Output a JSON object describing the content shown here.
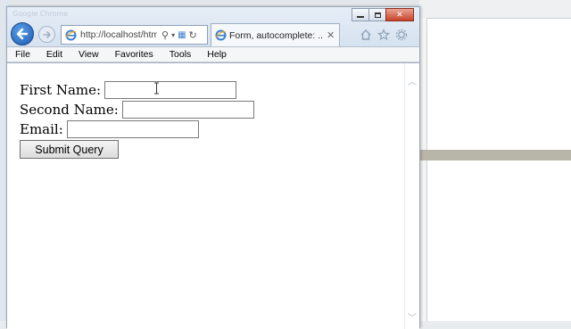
{
  "window": {
    "title_faint": "Google Chrome",
    "controls": [
      "minimize",
      "maximize",
      "close"
    ]
  },
  "address_bar": {
    "url": "http://localhost/htm",
    "icons": [
      "search-icon",
      "dropdown-icon",
      "compatibility-icon",
      "refresh-icon"
    ]
  },
  "tab": {
    "title": "Form, autocomplete: ...",
    "close": "✕"
  },
  "toolbar_icons": [
    "home-icon",
    "favorites-star-icon",
    "settings-gear-icon"
  ],
  "menu": {
    "items": [
      "File",
      "Edit",
      "View",
      "Favorites",
      "Tools",
      "Help"
    ]
  },
  "form": {
    "first_name_label": "First Name:",
    "first_name_value": "",
    "second_name_label": "Second Name:",
    "second_name_value": "",
    "email_label": "Email:",
    "email_value": "",
    "submit_label": "Submit Query"
  },
  "colors": {
    "back_button": "#1d5bb0",
    "close_button": "#c7432a"
  }
}
